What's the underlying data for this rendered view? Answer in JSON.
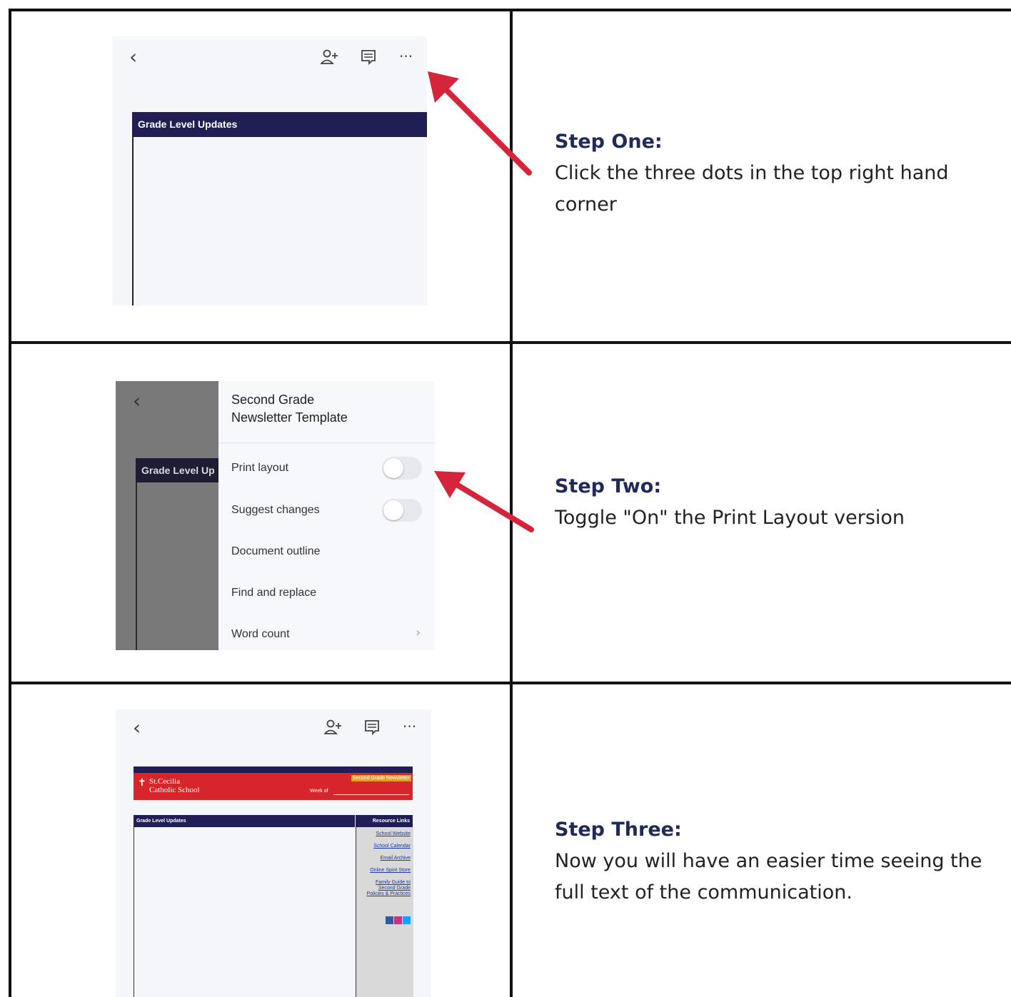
{
  "steps": [
    {
      "title": "Step One:",
      "body": "Click the three dots in the top right hand corner"
    },
    {
      "title": "Step Two:",
      "body": "Toggle \"On\" the Print Layout version"
    },
    {
      "title": "Step Three:",
      "body": "Now you will have an easier time seeing the full text of the communication."
    }
  ],
  "shot1": {
    "doc_header": "Grade Level Updates",
    "icons": [
      "back-chevron-icon",
      "add-person-icon",
      "comment-icon",
      "more-dots-icon"
    ]
  },
  "shot2": {
    "doc_header_partial": "Grade Level Up",
    "menu_title_line1": "Second Grade",
    "menu_title_line2": "Newsletter Template",
    "items": [
      "Print layout",
      "Suggest changes",
      "Document outline",
      "Find and replace",
      "Word count"
    ]
  },
  "shot3": {
    "school_line1": "St.Cecilia",
    "school_line2": "Catholic School",
    "newsletter_label": "Second Grade Newsletter",
    "week_of": "Week of",
    "grade_header": "Grade Level Updates",
    "resource_header": "Resource Links",
    "links": [
      "School Website",
      "School Calendar",
      "Email Archive",
      "Online Spirit Store",
      "Family Guide to",
      "Second Grade",
      "Policies & Practices"
    ]
  },
  "colors": {
    "navy": "#1f1f55",
    "red": "#d6262b",
    "arrow": "#d5253a",
    "step_title": "#1f2a5a"
  }
}
